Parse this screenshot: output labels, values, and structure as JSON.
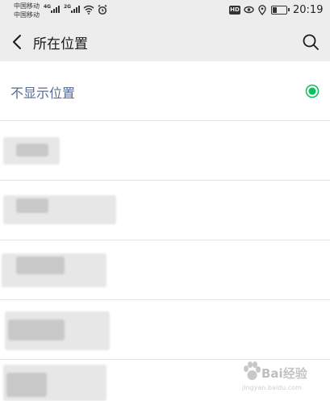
{
  "status_bar": {
    "carrier_1": "中国移动",
    "carrier_2": "中国移动",
    "network_1": "4G",
    "network_2": "2G",
    "hd_badge": "HD",
    "battery_level": 0.35,
    "time": "20:19"
  },
  "nav": {
    "title": "所在位置",
    "back_icon": "chevron-left-icon",
    "search_icon": "search-icon"
  },
  "list": {
    "items": [
      {
        "label": "不显示位置",
        "selected": true
      }
    ]
  },
  "colors": {
    "background": "#ededed",
    "link_blue": "#576b95",
    "radio_green": "#07c160"
  },
  "watermark": {
    "text": "Bai",
    "suffix": "经验",
    "sub": "jingyan.baidu.com"
  }
}
